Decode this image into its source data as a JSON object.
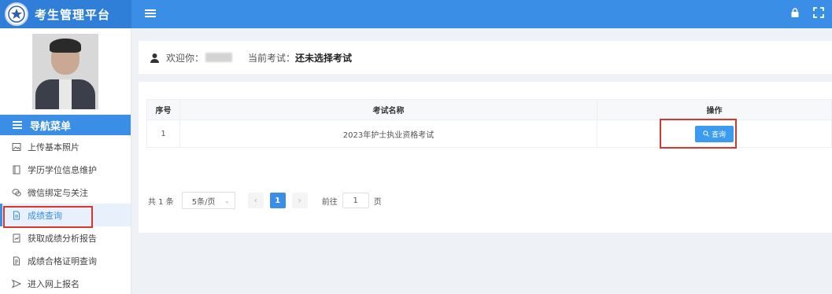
{
  "app": {
    "title": "考生管理平台"
  },
  "topbar": {
    "menu_icon": "menu-icon",
    "right_icons": [
      "lock-icon",
      "fullscreen-icon"
    ]
  },
  "sidebar": {
    "nav_header": "导航菜单",
    "items": [
      {
        "label": "上传基本照片",
        "icon": "image-icon"
      },
      {
        "label": "学历学位信息维护",
        "icon": "book-icon"
      },
      {
        "label": "微信绑定与关注",
        "icon": "wechat-icon"
      },
      {
        "label": "成绩查询",
        "icon": "document-icon",
        "active": true
      },
      {
        "label": "获取成绩分析报告",
        "icon": "report-icon"
      },
      {
        "label": "成绩合格证明查询",
        "icon": "certificate-icon"
      },
      {
        "label": "进入网上报名",
        "icon": "send-icon"
      }
    ]
  },
  "welcome": {
    "greeting": "欢迎你：",
    "current_exam_label": "当前考试：",
    "current_exam_value": "还未选择考试"
  },
  "table": {
    "columns": [
      "序号",
      "考试名称",
      "操作"
    ],
    "rows": [
      {
        "index": "1",
        "name": "2023年护士执业资格考试",
        "action": "查询"
      }
    ]
  },
  "pagination": {
    "total": "共 1 条",
    "page_size": "5条/页",
    "current_page": "1",
    "goto_label": "前往",
    "goto_value": "1",
    "page_suffix": "页"
  },
  "colors": {
    "primary": "#3a8ee6",
    "highlight": "#d9362b"
  }
}
